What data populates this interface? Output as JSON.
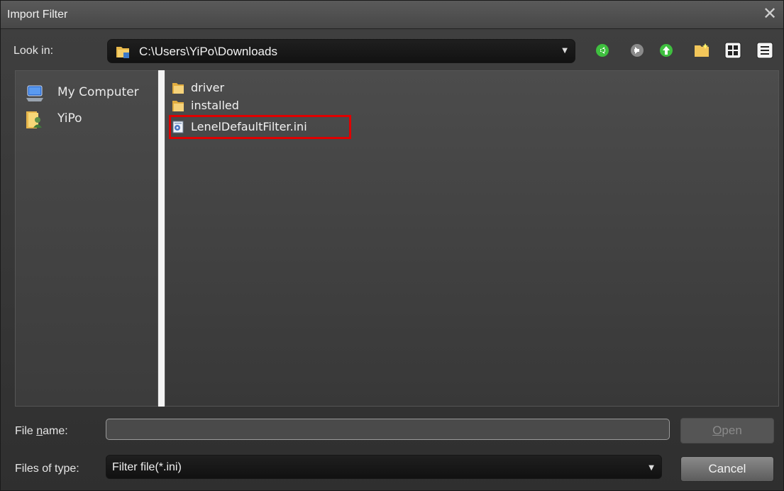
{
  "window": {
    "title": "Import Filter",
    "close_glyph": "✕"
  },
  "lookin": {
    "label": "Look in:",
    "path": "C:\\Users\\YiPo\\Downloads",
    "dropdown_glyph": "▼"
  },
  "toolbar": {
    "icons": [
      "back-icon",
      "forward-icon",
      "up-folder-icon",
      "new-folder-icon",
      "list-view-icon",
      "details-view-icon"
    ]
  },
  "places": [
    {
      "label": "My Computer",
      "icon": "computer-icon"
    },
    {
      "label": "YiPo",
      "icon": "user-folder-icon"
    }
  ],
  "files": [
    {
      "label": "driver",
      "icon": "folder-icon"
    },
    {
      "label": "installed",
      "icon": "folder-icon"
    },
    {
      "label": "LenelDefaultFilter.ini",
      "icon": "ini-file-icon",
      "highlighted": true
    }
  ],
  "filename": {
    "label_pre": "File ",
    "label_u": "n",
    "label_post": "ame:",
    "value": ""
  },
  "filetype": {
    "label": "Files of type:",
    "value": "Filter file(*.ini)",
    "dropdown_glyph": "▼"
  },
  "buttons": {
    "open_u": "O",
    "open_rest": "pen",
    "cancel": "Cancel"
  },
  "colors": {
    "highlight": "#e00000",
    "nav_green": "#3fbf3f"
  }
}
